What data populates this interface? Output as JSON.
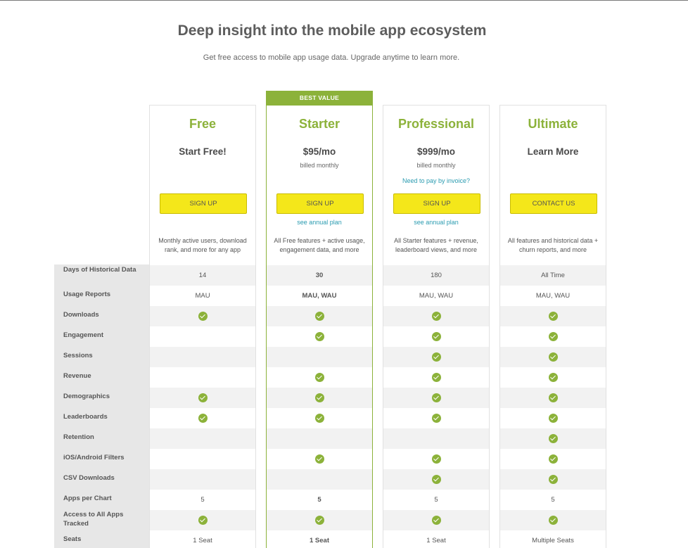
{
  "page": {
    "title": "Deep insight into the mobile app ecosystem",
    "subtitle": "Get free access to mobile app usage data. Upgrade anytime to learn more."
  },
  "badge": {
    "best_value": "BEST VALUE"
  },
  "plans": [
    {
      "name": "Free",
      "price": "Start Free!",
      "billing": "",
      "invoice": "",
      "button": "SIGN UP",
      "annual": "",
      "desc": "Monthly active users, download rank, and more for any app"
    },
    {
      "name": "Starter",
      "price": "$95/mo",
      "billing": "billed monthly",
      "invoice": "",
      "button": "SIGN UP",
      "annual": "see annual plan",
      "desc": "All Free features + active usage, engagement data, and more"
    },
    {
      "name": "Professional",
      "price": "$999/mo",
      "billing": "billed monthly",
      "invoice": "Need to pay by invoice?",
      "button": "SIGN UP",
      "annual": "see annual plan",
      "desc": "All Starter features + revenue, leaderboard views, and more"
    },
    {
      "name": "Ultimate",
      "price": "Learn More",
      "billing": "",
      "invoice": "",
      "button": "CONTACT US",
      "annual": "",
      "desc": "All features and historical data + churn reports, and more"
    }
  ],
  "features": [
    {
      "label": "Days of Historical Data",
      "values": [
        "14",
        "30",
        "180",
        "All Time"
      ]
    },
    {
      "label": "Usage Reports",
      "values": [
        "MAU",
        "MAU, WAU",
        "MAU, WAU",
        "MAU, WAU"
      ]
    },
    {
      "label": "Downloads",
      "values": [
        true,
        true,
        true,
        true
      ]
    },
    {
      "label": "Engagement",
      "values": [
        false,
        true,
        true,
        true
      ]
    },
    {
      "label": "Sessions",
      "values": [
        false,
        false,
        true,
        true
      ]
    },
    {
      "label": "Revenue",
      "values": [
        false,
        true,
        true,
        true
      ]
    },
    {
      "label": "Demographics",
      "values": [
        true,
        true,
        true,
        true
      ]
    },
    {
      "label": "Leaderboards",
      "values": [
        true,
        true,
        true,
        true
      ]
    },
    {
      "label": "Retention",
      "values": [
        false,
        false,
        false,
        true
      ]
    },
    {
      "label": "iOS/Android Filters",
      "values": [
        false,
        true,
        true,
        true
      ]
    },
    {
      "label": "CSV Downloads",
      "values": [
        false,
        false,
        true,
        true
      ]
    },
    {
      "label": "Apps per Chart",
      "values": [
        "5",
        "5",
        "5",
        "5"
      ]
    },
    {
      "label": "Access to All Apps Tracked",
      "values": [
        true,
        true,
        true,
        true
      ]
    },
    {
      "label": "Seats",
      "values": [
        "1 Seat",
        "1 Seat",
        "1 Seat",
        "Multiple Seats"
      ]
    }
  ],
  "colors": {
    "accent": "#8cb23a",
    "button": "#f4e71a",
    "link": "#2a9bb0"
  },
  "icons": {
    "included": "check-circle-icon"
  }
}
